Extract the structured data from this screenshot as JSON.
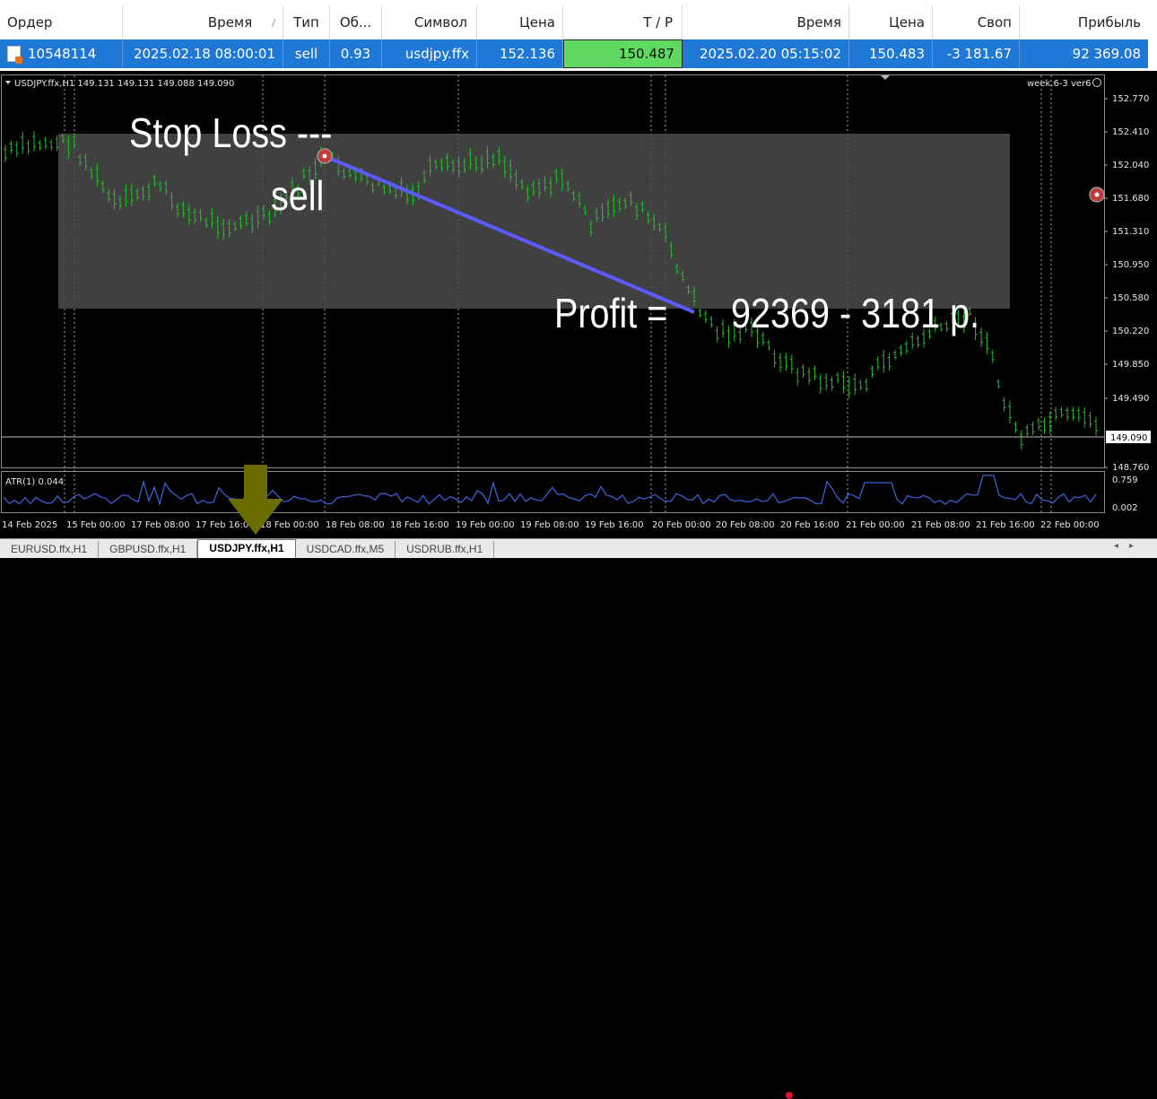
{
  "table": {
    "headers": [
      "Ордер",
      "Время",
      "Тип",
      "Об...",
      "Символ",
      "Цена",
      "Т / Р",
      "Время",
      "Цена",
      "Своп",
      "Прибыль"
    ],
    "sort_mark": "/",
    "row": {
      "order": "10548114",
      "open_time": "2025.02.18 08:00:01",
      "type": "sell",
      "volume": "0.93",
      "symbol": "usdjpy.ffx",
      "open_price": "152.136",
      "tp": "150.487",
      "close_time": "2025.02.20 05:15:02",
      "close_price": "150.483",
      "swap": "-3 181.67",
      "profit": "92 369.08"
    }
  },
  "chart": {
    "info": "USDJPY.ffx,H1  149.131 149.131 149.088 149.090",
    "indicator_label": "week.6-3 ver6",
    "atr_label": "ATR(1) 0.044",
    "current_price": "149.090",
    "price_ticks": [
      "152.770",
      "152.410",
      "152.040",
      "151.680",
      "151.310",
      "150.950",
      "150.580",
      "150.220",
      "149.850",
      "149.490",
      "149.090",
      "148.760"
    ],
    "atr_ticks": [
      "0.759",
      "0.002"
    ],
    "time_ticks": [
      "14 Feb 2025",
      "15 Feb 00:00",
      "17 Feb 08:00",
      "17 Feb 16:00",
      "18 Feb 00:00",
      "18 Feb 08:00",
      "18 Feb 16:00",
      "19 Feb 00:00",
      "19 Feb 08:00",
      "19 Feb 16:00",
      "20 Feb 00:00",
      "20 Feb 08:00",
      "20 Feb 16:00",
      "21 Feb 00:00",
      "21 Feb 08:00",
      "21 Feb 16:00",
      "22 Feb 00:00"
    ],
    "annotations": {
      "stop_loss": "Stop Loss ---",
      "sell": "sell",
      "profit_label": "Profit =",
      "profit_value": "92369 - 3181 р."
    },
    "colors": {
      "candle": "#22c12a",
      "trade_line": "#5b5bff",
      "background": "#000000",
      "grid": "#3a3a3a"
    }
  },
  "tabs": [
    {
      "label": "EURUSD.ffx,H1",
      "active": false
    },
    {
      "label": "GBPUSD.ffx,H1",
      "active": false
    },
    {
      "label": "USDJPY.ffx,H1",
      "active": true
    },
    {
      "label": "USDCAD.ffx,M5",
      "active": false
    },
    {
      "label": "USDRUB.ffx,H1",
      "active": false
    }
  ]
}
